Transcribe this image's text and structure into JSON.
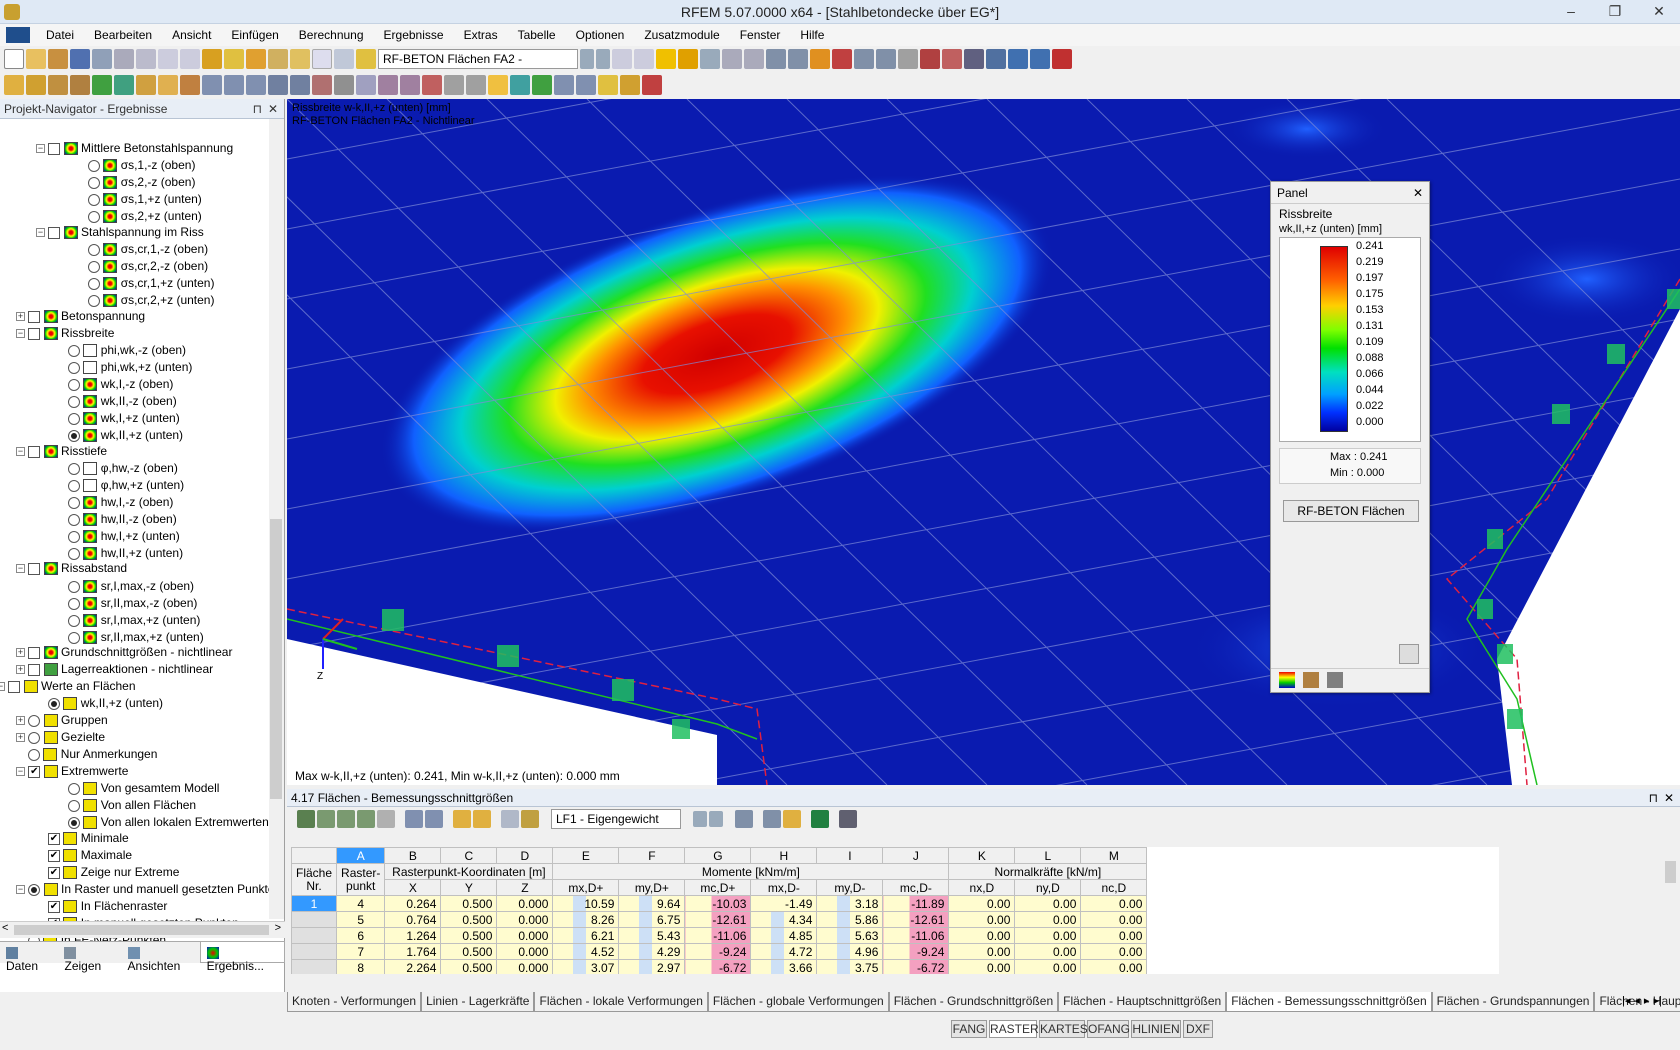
{
  "window": {
    "title": "RFEM 5.07.0000 x64 - [Stahlbetondecke über EG*]"
  },
  "menu": [
    "Datei",
    "Bearbeiten",
    "Ansicht",
    "Einfügen",
    "Berechnung",
    "Ergebnisse",
    "Extras",
    "Tabelle",
    "Optionen",
    "Zusatzmodule",
    "Fenster",
    "Hilfe"
  ],
  "toolbar": {
    "case_select": "RF-BETON Flächen FA2 - Nichtlinear"
  },
  "navigator": {
    "title": "Projekt-Navigator - Ergebnisse",
    "items": [
      {
        "label": "Mittlere Betonstahlspannung",
        "sub": ""
      },
      {
        "label": "σs,1,-z (oben)"
      },
      {
        "label": "σs,2,-z (oben)"
      },
      {
        "label": "σs,1,+z (unten)"
      },
      {
        "label": "σs,2,+z (unten)"
      },
      {
        "label": "Stahlspannung im Riss"
      },
      {
        "label": "σs,cr,1,-z (oben)"
      },
      {
        "label": "σs,cr,2,-z (oben)"
      },
      {
        "label": "σs,cr,1,+z (unten)"
      },
      {
        "label": "σs,cr,2,+z (unten)"
      },
      {
        "label": "Betonspannung"
      },
      {
        "label": "Rissbreite"
      },
      {
        "label": "phi,wk,-z (oben)"
      },
      {
        "label": "phi,wk,+z (unten)"
      },
      {
        "label": "wk,I,-z (oben)"
      },
      {
        "label": "wk,II,-z (oben)"
      },
      {
        "label": "wk,I,+z (unten)"
      },
      {
        "label": "wk,II,+z (unten)"
      },
      {
        "label": "Risstiefe"
      },
      {
        "label": "φ,hw,-z (oben)"
      },
      {
        "label": "φ,hw,+z (unten)"
      },
      {
        "label": "hw,I,-z (oben)"
      },
      {
        "label": "hw,II,-z (oben)"
      },
      {
        "label": "hw,I,+z (unten)"
      },
      {
        "label": "hw,II,+z (unten)"
      },
      {
        "label": "Rissabstand"
      },
      {
        "label": "sr,I,max,-z (oben)"
      },
      {
        "label": "sr,II,max,-z (oben)"
      },
      {
        "label": "sr,I,max,+z (unten)"
      },
      {
        "label": "sr,II,max,+z (unten)"
      },
      {
        "label": "Grundschnittgrößen - nichtlinear"
      },
      {
        "label": "Lagerreaktionen - nichtlinear"
      },
      {
        "label": "Werte an Flächen"
      },
      {
        "label": "wk,II,+z (unten)"
      },
      {
        "label": "Gruppen"
      },
      {
        "label": "Gezielte"
      },
      {
        "label": "Nur Anmerkungen"
      },
      {
        "label": "Extremwerte"
      },
      {
        "label": "Von gesamtem Modell"
      },
      {
        "label": "Von allen Flächen"
      },
      {
        "label": "Von allen lokalen Extremwerten"
      },
      {
        "label": "Minimale"
      },
      {
        "label": "Maximale"
      },
      {
        "label": "Zeige nur Extreme"
      },
      {
        "label": "In Raster und manuell gesetzten Punkten"
      },
      {
        "label": "In Flächenraster"
      },
      {
        "label": "In manuell gesetzten Punkten"
      },
      {
        "label": "In FE-Netz-Punkten"
      }
    ],
    "bottom_tabs": [
      "Daten",
      "Zeigen",
      "Ansichten",
      "Ergebnis..."
    ]
  },
  "viewport": {
    "line1": "Rissbreite w-k,II,+z (unten) [mm]",
    "line2": "RF-BETON Flächen FA2 - Nichtlinear",
    "maxmin": "Max w-k,II,+z (unten): 0.241, Min w-k,II,+z (unten): 0.000 mm",
    "axis_z": "Z"
  },
  "panel": {
    "title": "Panel",
    "heading": "Rissbreite",
    "unit": "wk,II,+z (unten) [mm]",
    "legend": [
      "0.241",
      "0.219",
      "0.197",
      "0.175",
      "0.153",
      "0.131",
      "0.109",
      "0.088",
      "0.066",
      "0.044",
      "0.022",
      "0.000"
    ],
    "max_label": "Max  :  0.241",
    "min_label": "Min  :  0.000",
    "button": "RF-BETON Flächen"
  },
  "table": {
    "title": "4.17 Flächen - Bemessungsschnittgrößen",
    "lf_select": "LF1 - Eigengewicht",
    "col_letters": [
      "A",
      "B",
      "C",
      "D",
      "E",
      "F",
      "G",
      "H",
      "I",
      "J",
      "K",
      "L",
      "M"
    ],
    "head1": {
      "flaeche": "Fläche Nr.",
      "raster": "Raster- punkt",
      "coords": "Rasterpunkt-Koordinaten [m]",
      "momente": "Momente [kNm/m]",
      "normal": "Normalkräfte [kN/m]"
    },
    "head2": [
      "X",
      "Y",
      "Z",
      "mx,D+",
      "my,D+",
      "mc,D+",
      "mx,D-",
      "my,D-",
      "mc,D-",
      "nx,D",
      "ny,D",
      "nc,D"
    ],
    "rows": [
      [
        "1",
        "4",
        "0.264",
        "0.500",
        "0.000",
        "10.59",
        "9.64",
        "-10.03",
        "-1.49",
        "3.18",
        "-11.89",
        "0.00",
        "0.00",
        "0.00"
      ],
      [
        "",
        "5",
        "0.764",
        "0.500",
        "0.000",
        "8.26",
        "6.75",
        "-12.61",
        "4.34",
        "5.86",
        "-12.61",
        "0.00",
        "0.00",
        "0.00"
      ],
      [
        "",
        "6",
        "1.264",
        "0.500",
        "0.000",
        "6.21",
        "5.43",
        "-11.06",
        "4.85",
        "5.63",
        "-11.06",
        "0.00",
        "0.00",
        "0.00"
      ],
      [
        "",
        "7",
        "1.764",
        "0.500",
        "0.000",
        "4.52",
        "4.29",
        "-9.24",
        "4.72",
        "4.96",
        "-9.24",
        "0.00",
        "0.00",
        "0.00"
      ],
      [
        "",
        "8",
        "2.264",
        "0.500",
        "0.000",
        "3.07",
        "2.97",
        "-6.72",
        "3.66",
        "3.75",
        "-6.72",
        "0.00",
        "0.00",
        "0.00"
      ]
    ],
    "tabs": [
      "Knoten - Verformungen",
      "Linien - Lagerkräfte",
      "Flächen - lokale Verformungen",
      "Flächen - globale Verformungen",
      "Flächen - Grundschnittgrößen",
      "Flächen - Hauptschnittgrößen",
      "Flächen - Bemessungsschnittgrößen",
      "Flächen - Grundspannungen",
      "Flächen - Hauptspannungen"
    ]
  },
  "status": [
    "FANG",
    "RASTER",
    "KARTES",
    "OFANG",
    "HLINIEN",
    "DXF"
  ]
}
